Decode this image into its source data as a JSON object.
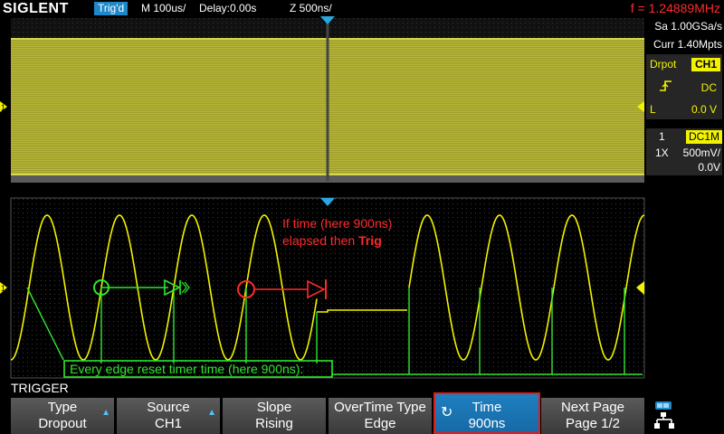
{
  "header": {
    "logo": "SIGLENT",
    "trig_status": "Trig'd",
    "timebase": "M 100us/",
    "delay": "Delay:0.00s",
    "zoom": "Z 500ns/",
    "frequency": "f = 1.24889MHz"
  },
  "side_panel": {
    "sample_rate": "Sa 1.00GSa/s",
    "memory": "Curr 1.40Mpts",
    "trigger_type": "Drpot",
    "trigger_source": "CH1",
    "coupling": "DC",
    "level_label": "L",
    "level_value": "0.0 V",
    "channel_number": "1",
    "channel_coupling": "DC1M",
    "probe": "1X",
    "vdiv": "500mV/",
    "offset": "0.0V"
  },
  "channel_marker_label": "1",
  "annotations": {
    "red_line1": "If time (here 900ns)",
    "red_line2_prefix": "elapsed then ",
    "red_line2_bold": "Trig",
    "green_box": "Every edge reset timer time (here 900ns):"
  },
  "menu": {
    "title": "TRIGGER",
    "keys": [
      {
        "line1": "Type",
        "line2": "Dropout"
      },
      {
        "line1": "Source",
        "line2": "CH1"
      },
      {
        "line1": "Slope",
        "line2": "Rising"
      },
      {
        "line1": "OverTime Type",
        "line2": "Edge"
      },
      {
        "line1": "Time",
        "line2": "900ns"
      },
      {
        "line1": "Next Page",
        "line2": "Page 1/2"
      }
    ]
  },
  "colors": {
    "trace": "#f2f200",
    "accent": "#1e88c8",
    "annotation_red": "#ff2a2a",
    "annotation_green": "#2ee82e"
  },
  "icons": [
    "network-icon",
    "rotate-knob-icon",
    "up-arrow-icon",
    "rising-edge-icon"
  ]
}
